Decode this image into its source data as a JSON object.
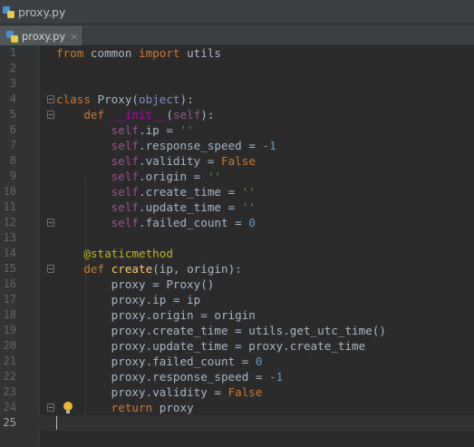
{
  "window": {
    "title": "proxy.py"
  },
  "tabs": [
    {
      "label": "proxy.py",
      "close": "×",
      "active": true
    }
  ],
  "editor": {
    "current_line": 25,
    "lines": [
      {
        "n": "1",
        "tokens": [
          [
            "kw",
            "from"
          ],
          [
            "plain",
            " common "
          ],
          [
            "kw",
            "import"
          ],
          [
            "plain",
            " utils"
          ]
        ]
      },
      {
        "n": "2",
        "tokens": []
      },
      {
        "n": "3",
        "tokens": []
      },
      {
        "n": "4",
        "tokens": [
          [
            "kw",
            "class"
          ],
          [
            "plain",
            " Proxy("
          ],
          [
            "builtin",
            "object"
          ],
          [
            "plain",
            "):"
          ]
        ],
        "fold": true
      },
      {
        "n": "5",
        "tokens": [
          [
            "plain",
            "    "
          ],
          [
            "kw",
            "def"
          ],
          [
            "plain",
            " "
          ],
          [
            "dunder",
            "__init__"
          ],
          [
            "plain",
            "("
          ],
          [
            "self",
            "self"
          ],
          [
            "plain",
            "):"
          ]
        ],
        "fold": true
      },
      {
        "n": "6",
        "tokens": [
          [
            "plain",
            "        "
          ],
          [
            "self",
            "self"
          ],
          [
            "plain",
            ".ip = "
          ],
          [
            "str",
            "''"
          ]
        ]
      },
      {
        "n": "7",
        "tokens": [
          [
            "plain",
            "        "
          ],
          [
            "self",
            "self"
          ],
          [
            "plain",
            ".response_speed = "
          ],
          [
            "num",
            "-1"
          ]
        ]
      },
      {
        "n": "8",
        "tokens": [
          [
            "plain",
            "        "
          ],
          [
            "self",
            "self"
          ],
          [
            "plain",
            ".validity = "
          ],
          [
            "kw",
            "False"
          ]
        ]
      },
      {
        "n": "9",
        "tokens": [
          [
            "plain",
            "        "
          ],
          [
            "self",
            "self"
          ],
          [
            "plain",
            ".origin = "
          ],
          [
            "str",
            "''"
          ]
        ]
      },
      {
        "n": "10",
        "tokens": [
          [
            "plain",
            "        "
          ],
          [
            "self",
            "self"
          ],
          [
            "plain",
            ".create_time = "
          ],
          [
            "str",
            "''"
          ]
        ]
      },
      {
        "n": "11",
        "tokens": [
          [
            "plain",
            "        "
          ],
          [
            "self",
            "self"
          ],
          [
            "plain",
            ".update_time = "
          ],
          [
            "str",
            "''"
          ]
        ]
      },
      {
        "n": "12",
        "tokens": [
          [
            "plain",
            "        "
          ],
          [
            "self",
            "self"
          ],
          [
            "plain",
            ".failed_count = "
          ],
          [
            "num",
            "0"
          ]
        ],
        "fold": true
      },
      {
        "n": "13",
        "tokens": []
      },
      {
        "n": "14",
        "tokens": [
          [
            "plain",
            "    "
          ],
          [
            "deco",
            "@staticmethod"
          ]
        ]
      },
      {
        "n": "15",
        "tokens": [
          [
            "plain",
            "    "
          ],
          [
            "kw",
            "def"
          ],
          [
            "plain",
            " "
          ],
          [
            "fn",
            "create"
          ],
          [
            "plain",
            "(ip, origin):"
          ]
        ],
        "fold": true
      },
      {
        "n": "16",
        "tokens": [
          [
            "plain",
            "        proxy = Proxy()"
          ]
        ]
      },
      {
        "n": "17",
        "tokens": [
          [
            "plain",
            "        proxy.ip = ip"
          ]
        ]
      },
      {
        "n": "18",
        "tokens": [
          [
            "plain",
            "        proxy.origin = origin"
          ]
        ]
      },
      {
        "n": "19",
        "tokens": [
          [
            "plain",
            "        proxy.create_time = utils.get_utc_time()"
          ]
        ]
      },
      {
        "n": "20",
        "tokens": [
          [
            "plain",
            "        proxy.update_time = proxy.create_time"
          ]
        ]
      },
      {
        "n": "21",
        "tokens": [
          [
            "plain",
            "        proxy.failed_count = "
          ],
          [
            "num",
            "0"
          ]
        ]
      },
      {
        "n": "22",
        "tokens": [
          [
            "plain",
            "        proxy.response_speed = "
          ],
          [
            "num",
            "-1"
          ]
        ]
      },
      {
        "n": "23",
        "tokens": [
          [
            "plain",
            "        proxy.validity = "
          ],
          [
            "kw",
            "False"
          ]
        ]
      },
      {
        "n": "24",
        "tokens": [
          [
            "plain",
            "        "
          ],
          [
            "kw",
            "return"
          ],
          [
            "plain",
            " proxy"
          ]
        ],
        "fold": true,
        "bulb": true
      },
      {
        "n": "25",
        "tokens": []
      }
    ]
  },
  "icons": {
    "file": "python-file-icon",
    "fold": "fold-marker-icon",
    "intention": "lightbulb-icon"
  },
  "colors": {
    "background": "#2b2b2b",
    "keyword": "#cc7832",
    "self": "#94558d",
    "string": "#6a8759",
    "number": "#6897bb",
    "decorator": "#bbb529",
    "function": "#ffc66d",
    "text": "#a9b7c6"
  }
}
